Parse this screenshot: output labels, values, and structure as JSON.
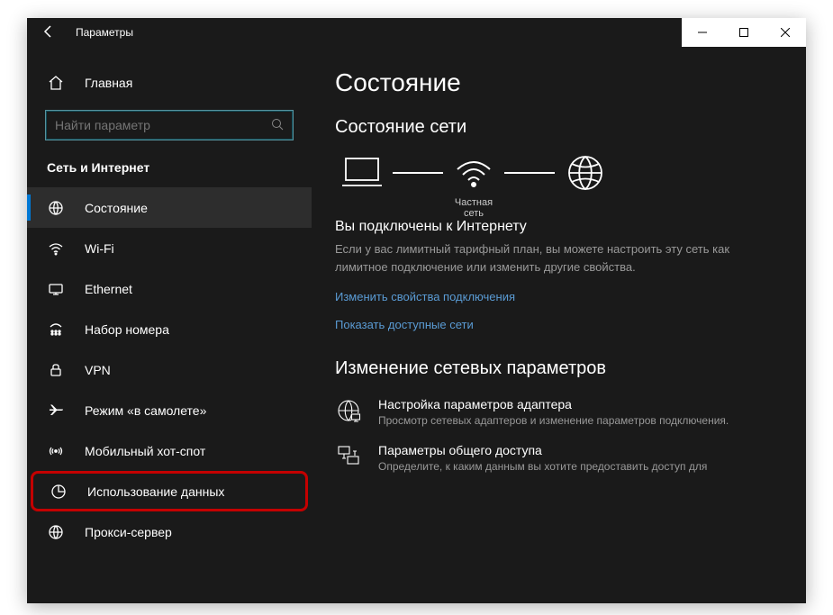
{
  "window": {
    "title": "Параметры"
  },
  "sidebar": {
    "home": "Главная",
    "search_placeholder": "Найти параметр",
    "category": "Сеть и Интернет",
    "items": [
      {
        "label": "Состояние"
      },
      {
        "label": "Wi-Fi"
      },
      {
        "label": "Ethernet"
      },
      {
        "label": "Набор номера"
      },
      {
        "label": "VPN"
      },
      {
        "label": "Режим «в самолете»"
      },
      {
        "label": "Мобильный хот-спот"
      },
      {
        "label": "Использование данных"
      },
      {
        "label": "Прокси-сервер"
      }
    ]
  },
  "main": {
    "h1": "Состояние",
    "h2": "Состояние сети",
    "net_label": "Частная сеть",
    "connected_head": "Вы подключены к Интернету",
    "connected_text": "Если у вас лимитный тарифный план, вы можете настроить эту сеть как лимитное подключение или изменить другие свойства.",
    "link1": "Изменить свойства подключения",
    "link2": "Показать доступные сети",
    "h2b": "Изменение сетевых параметров",
    "opt1_title": "Настройка параметров адаптера",
    "opt1_desc": "Просмотр сетевых адаптеров и изменение параметров подключения.",
    "opt2_title": "Параметры общего доступа",
    "opt2_desc": "Определите, к каким данным вы хотите предоставить доступ для"
  }
}
